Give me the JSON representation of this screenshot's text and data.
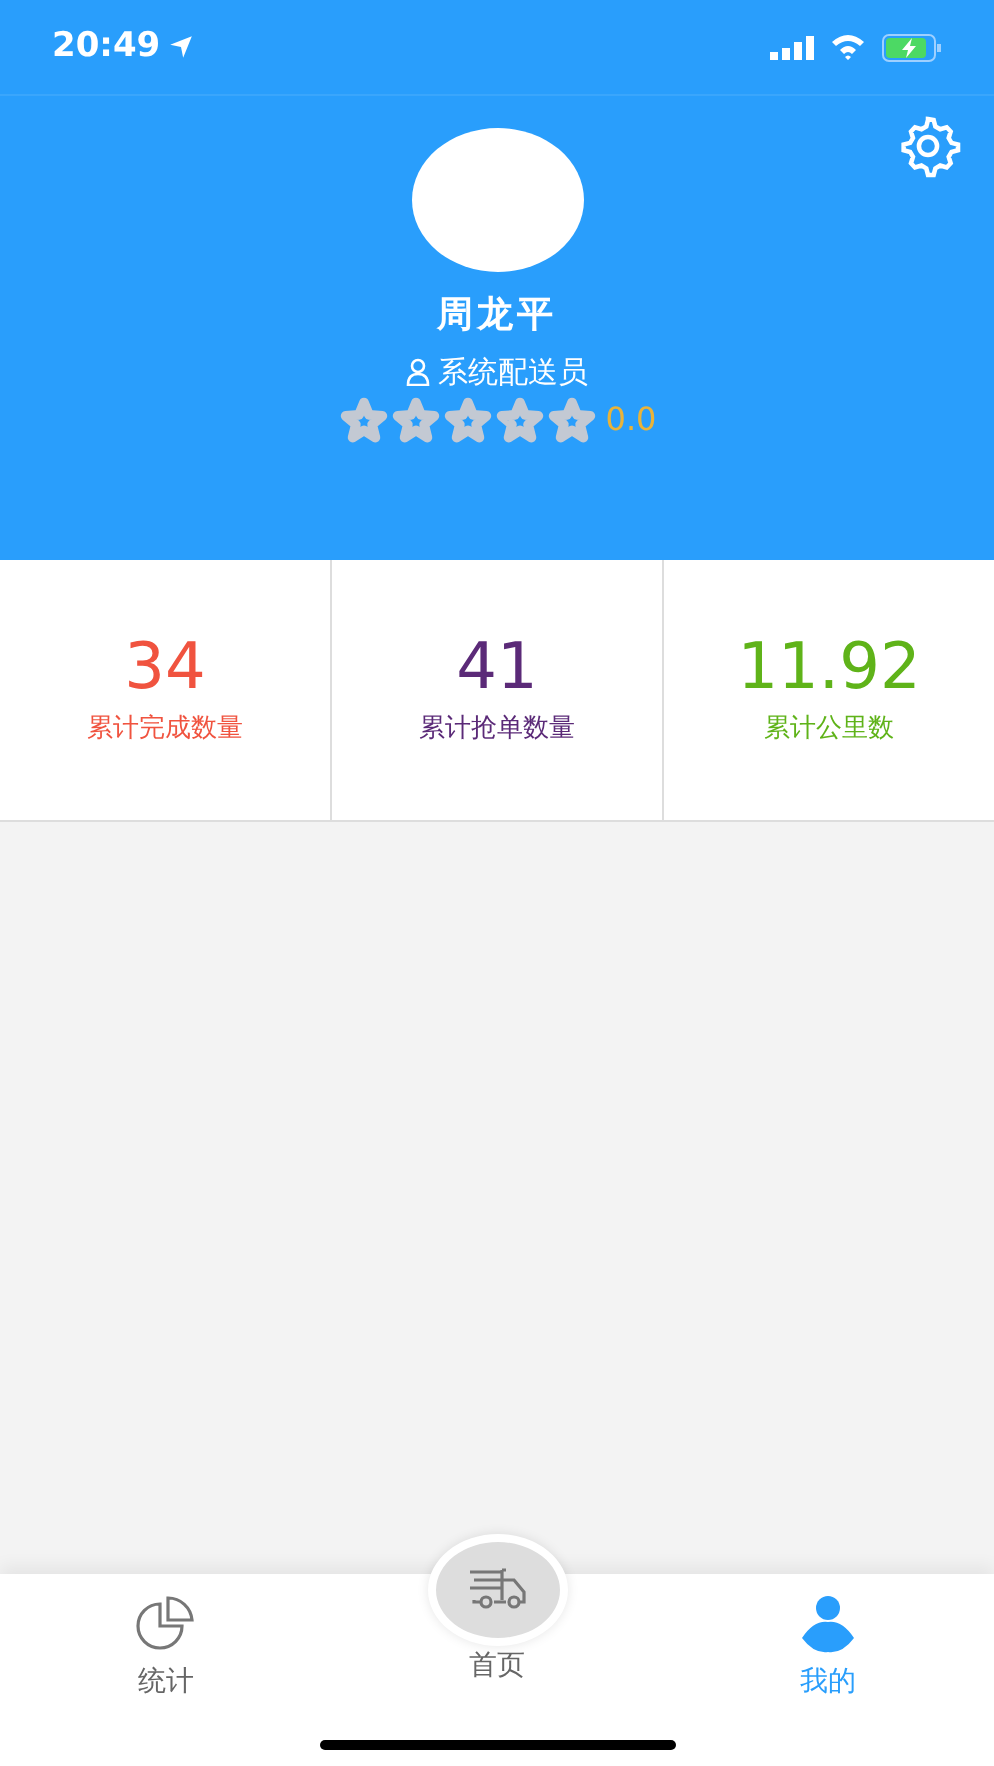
{
  "status_bar": {
    "time": "20:49"
  },
  "profile": {
    "name": "周龙平",
    "role": "系统配送员",
    "stars": 0,
    "rating": "0.0"
  },
  "stats": [
    {
      "value": "34",
      "label": "累计完成数量",
      "color": "#f0533f"
    },
    {
      "value": "41",
      "label": "累计抢单数量",
      "color": "#5b2a78"
    },
    {
      "value": "11.92",
      "label": "累计公里数",
      "color": "#5fb319"
    }
  ],
  "tabs": [
    {
      "kind": "chart",
      "label": "统计",
      "selected": false
    },
    {
      "kind": "truck",
      "label": "首页",
      "selected": false
    },
    {
      "kind": "person",
      "label": "我的",
      "selected": true
    }
  ]
}
